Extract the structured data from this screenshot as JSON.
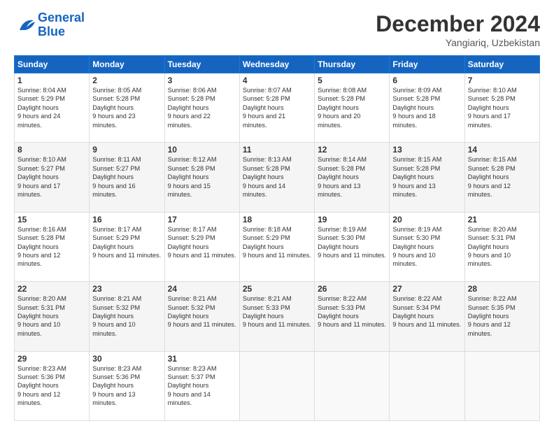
{
  "logo": {
    "line1": "General",
    "line2": "Blue"
  },
  "title": "December 2024",
  "location": "Yangiariq, Uzbekistan",
  "weekdays": [
    "Sunday",
    "Monday",
    "Tuesday",
    "Wednesday",
    "Thursday",
    "Friday",
    "Saturday"
  ],
  "weeks": [
    [
      {
        "day": "1",
        "sunrise": "8:04 AM",
        "sunset": "5:29 PM",
        "daylight": "9 hours and 24 minutes."
      },
      {
        "day": "2",
        "sunrise": "8:05 AM",
        "sunset": "5:28 PM",
        "daylight": "9 hours and 23 minutes."
      },
      {
        "day": "3",
        "sunrise": "8:06 AM",
        "sunset": "5:28 PM",
        "daylight": "9 hours and 22 minutes."
      },
      {
        "day": "4",
        "sunrise": "8:07 AM",
        "sunset": "5:28 PM",
        "daylight": "9 hours and 21 minutes."
      },
      {
        "day": "5",
        "sunrise": "8:08 AM",
        "sunset": "5:28 PM",
        "daylight": "9 hours and 20 minutes."
      },
      {
        "day": "6",
        "sunrise": "8:09 AM",
        "sunset": "5:28 PM",
        "daylight": "9 hours and 18 minutes."
      },
      {
        "day": "7",
        "sunrise": "8:10 AM",
        "sunset": "5:28 PM",
        "daylight": "9 hours and 17 minutes."
      }
    ],
    [
      {
        "day": "8",
        "sunrise": "8:10 AM",
        "sunset": "5:27 PM",
        "daylight": "9 hours and 17 minutes."
      },
      {
        "day": "9",
        "sunrise": "8:11 AM",
        "sunset": "5:27 PM",
        "daylight": "9 hours and 16 minutes."
      },
      {
        "day": "10",
        "sunrise": "8:12 AM",
        "sunset": "5:28 PM",
        "daylight": "9 hours and 15 minutes."
      },
      {
        "day": "11",
        "sunrise": "8:13 AM",
        "sunset": "5:28 PM",
        "daylight": "9 hours and 14 minutes."
      },
      {
        "day": "12",
        "sunrise": "8:14 AM",
        "sunset": "5:28 PM",
        "daylight": "9 hours and 13 minutes."
      },
      {
        "day": "13",
        "sunrise": "8:15 AM",
        "sunset": "5:28 PM",
        "daylight": "9 hours and 13 minutes."
      },
      {
        "day": "14",
        "sunrise": "8:15 AM",
        "sunset": "5:28 PM",
        "daylight": "9 hours and 12 minutes."
      }
    ],
    [
      {
        "day": "15",
        "sunrise": "8:16 AM",
        "sunset": "5:28 PM",
        "daylight": "9 hours and 12 minutes."
      },
      {
        "day": "16",
        "sunrise": "8:17 AM",
        "sunset": "5:29 PM",
        "daylight": "9 hours and 11 minutes."
      },
      {
        "day": "17",
        "sunrise": "8:17 AM",
        "sunset": "5:29 PM",
        "daylight": "9 hours and 11 minutes."
      },
      {
        "day": "18",
        "sunrise": "8:18 AM",
        "sunset": "5:29 PM",
        "daylight": "9 hours and 11 minutes."
      },
      {
        "day": "19",
        "sunrise": "8:19 AM",
        "sunset": "5:30 PM",
        "daylight": "9 hours and 11 minutes."
      },
      {
        "day": "20",
        "sunrise": "8:19 AM",
        "sunset": "5:30 PM",
        "daylight": "9 hours and 10 minutes."
      },
      {
        "day": "21",
        "sunrise": "8:20 AM",
        "sunset": "5:31 PM",
        "daylight": "9 hours and 10 minutes."
      }
    ],
    [
      {
        "day": "22",
        "sunrise": "8:20 AM",
        "sunset": "5:31 PM",
        "daylight": "9 hours and 10 minutes."
      },
      {
        "day": "23",
        "sunrise": "8:21 AM",
        "sunset": "5:32 PM",
        "daylight": "9 hours and 10 minutes."
      },
      {
        "day": "24",
        "sunrise": "8:21 AM",
        "sunset": "5:32 PM",
        "daylight": "9 hours and 11 minutes."
      },
      {
        "day": "25",
        "sunrise": "8:21 AM",
        "sunset": "5:33 PM",
        "daylight": "9 hours and 11 minutes."
      },
      {
        "day": "26",
        "sunrise": "8:22 AM",
        "sunset": "5:33 PM",
        "daylight": "9 hours and 11 minutes."
      },
      {
        "day": "27",
        "sunrise": "8:22 AM",
        "sunset": "5:34 PM",
        "daylight": "9 hours and 11 minutes."
      },
      {
        "day": "28",
        "sunrise": "8:22 AM",
        "sunset": "5:35 PM",
        "daylight": "9 hours and 12 minutes."
      }
    ],
    [
      {
        "day": "29",
        "sunrise": "8:23 AM",
        "sunset": "5:36 PM",
        "daylight": "9 hours and 12 minutes."
      },
      {
        "day": "30",
        "sunrise": "8:23 AM",
        "sunset": "5:36 PM",
        "daylight": "9 hours and 13 minutes."
      },
      {
        "day": "31",
        "sunrise": "8:23 AM",
        "sunset": "5:37 PM",
        "daylight": "9 hours and 14 minutes."
      },
      null,
      null,
      null,
      null
    ]
  ]
}
